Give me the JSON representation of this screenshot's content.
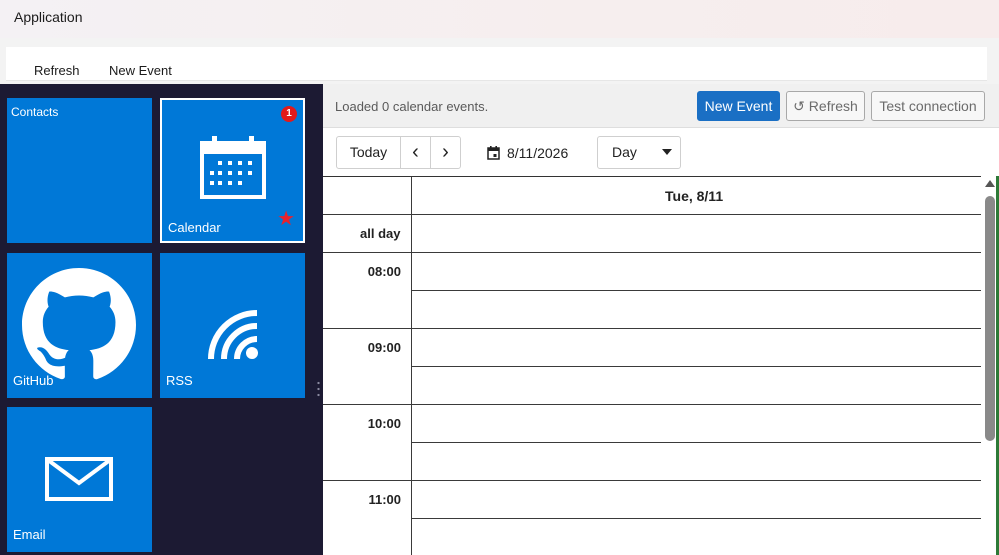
{
  "window": {
    "title": "Application"
  },
  "menu": {
    "items": [
      "Refresh",
      "New Event"
    ]
  },
  "tiles": [
    {
      "label": "Contacts",
      "icon": "contacts-icon"
    },
    {
      "label": "Calendar",
      "icon": "calendar-icon",
      "badge": "1",
      "starred": true
    },
    {
      "label": "GitHub",
      "icon": "github-icon"
    },
    {
      "label": "RSS",
      "icon": "rss-icon"
    },
    {
      "label": "Email",
      "icon": "email-icon"
    }
  ],
  "calendar": {
    "status": "Loaded 0 calendar events.",
    "buttons": {
      "new_event": "New Event",
      "refresh": "↺ Refresh",
      "test": "Test connection"
    },
    "nav": {
      "today": "Today",
      "prev": "‹",
      "next": "›"
    },
    "date": "8/11/2026",
    "view": "Day",
    "day_header": "Tue, 8/11",
    "all_day": "all day",
    "hours": [
      "08:00",
      "09:00",
      "10:00",
      "11:00"
    ]
  },
  "colors": {
    "tile_blue": "#0078d7",
    "pane_dark": "#1c1a33",
    "primary_button": "#1a6fc4",
    "badge_red": "#e21a1a"
  }
}
